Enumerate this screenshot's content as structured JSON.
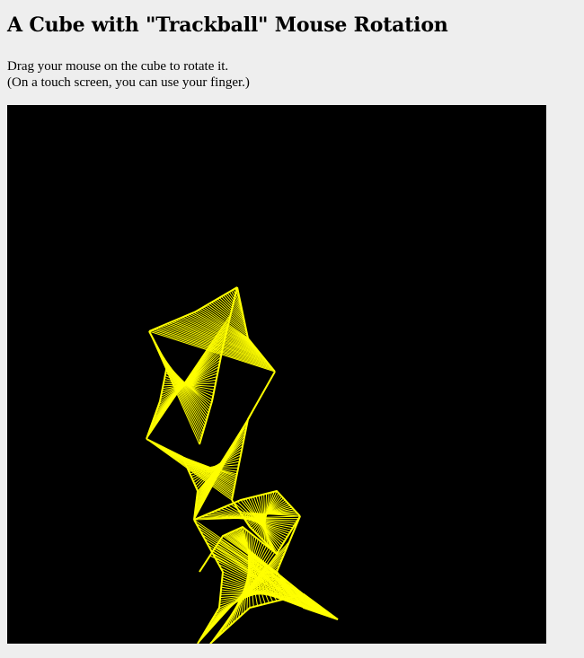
{
  "page": {
    "title": "A Cube with \"Trackball\" Mouse Rotation",
    "instructions": [
      "Drag your mouse on the cube to rotate it.",
      "(On a touch screen, you can use your finger.)"
    ]
  },
  "canvas": {
    "background": "#000000",
    "stroke_color": "#ffff00"
  }
}
